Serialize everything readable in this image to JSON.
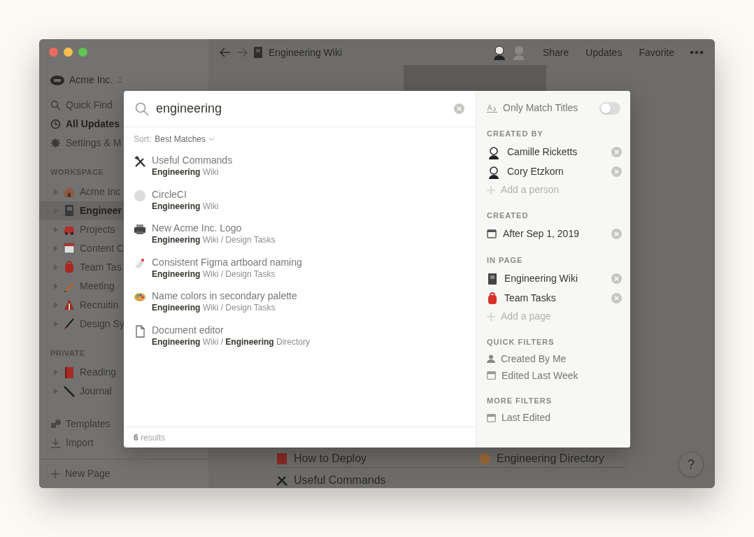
{
  "sidebar": {
    "workspace": "Acme Inc.",
    "nav": [
      {
        "label": "Quick Find",
        "selected": false
      },
      {
        "label": "All Updates",
        "selected": true
      },
      {
        "label": "Settings & M",
        "selected": false
      }
    ],
    "sections": [
      {
        "title": "WORKSPACE",
        "items": [
          {
            "label": "Acme Inc",
            "selected": false
          },
          {
            "label": "Engineer",
            "selected": true
          },
          {
            "label": "Projects",
            "selected": false
          },
          {
            "label": "Content C",
            "selected": false
          },
          {
            "label": "Team Tas",
            "selected": false
          },
          {
            "label": "Meeting",
            "selected": false
          },
          {
            "label": "Recruitin",
            "selected": false
          },
          {
            "label": "Design Sy",
            "selected": false
          }
        ]
      },
      {
        "title": "PRIVATE",
        "items": [
          {
            "label": "Reading",
            "selected": false
          },
          {
            "label": "Journal",
            "selected": false
          }
        ]
      }
    ],
    "bottom": [
      "Templates",
      "Import"
    ],
    "new_page": "New Page"
  },
  "topbar": {
    "title": "Engineering Wiki",
    "actions": [
      "Share",
      "Updates",
      "Favorite"
    ]
  },
  "content": {
    "links": [
      "How to Deploy",
      "Engineering Directory",
      "Useful Commands"
    ],
    "help": "?"
  },
  "search": {
    "query": "engineering",
    "sort_label": "Sort:",
    "sort_value": "Best Matches",
    "results": [
      {
        "title": "Useful Commands",
        "path": "**Engineering** Wiki"
      },
      {
        "title": "CircleCI",
        "path": "**Engineering** Wiki"
      },
      {
        "title": "New Acme Inc. Logo",
        "path": "**Engineering** Wiki / Design Tasks"
      },
      {
        "title": "Consistent Figma artboard naming",
        "path": "**Engineering** Wiki / Design Tasks"
      },
      {
        "title": "Name colors in secondary palette",
        "path": "**Engineering** Wiki / Design Tasks"
      },
      {
        "title": "Document editor",
        "path": "**Engineering** Wiki / **Engineering** Directory"
      }
    ],
    "footer": "**6** results"
  },
  "filters": {
    "only_match_titles": {
      "label": "Only Match Titles",
      "on": false
    },
    "sections": [
      {
        "title": "CREATED BY",
        "items": [
          {
            "label": "Camille Ricketts"
          },
          {
            "label": "Cory Etzkorn"
          }
        ],
        "add": "Add a person"
      },
      {
        "title": "CREATED",
        "items": [
          {
            "label": "After Sep 1, 2019"
          }
        ]
      },
      {
        "title": "IN PAGE",
        "items": [
          {
            "label": "Engineering Wiki"
          },
          {
            "label": "Team Tasks"
          }
        ],
        "add": "Add a page"
      }
    ],
    "quick_filters": {
      "title": "QUICK FILTERS",
      "items": [
        "Created By Me",
        "Edited Last Week"
      ]
    },
    "more_filters": {
      "title": "MORE FILTERS",
      "items": [
        "Last Edited"
      ]
    }
  }
}
